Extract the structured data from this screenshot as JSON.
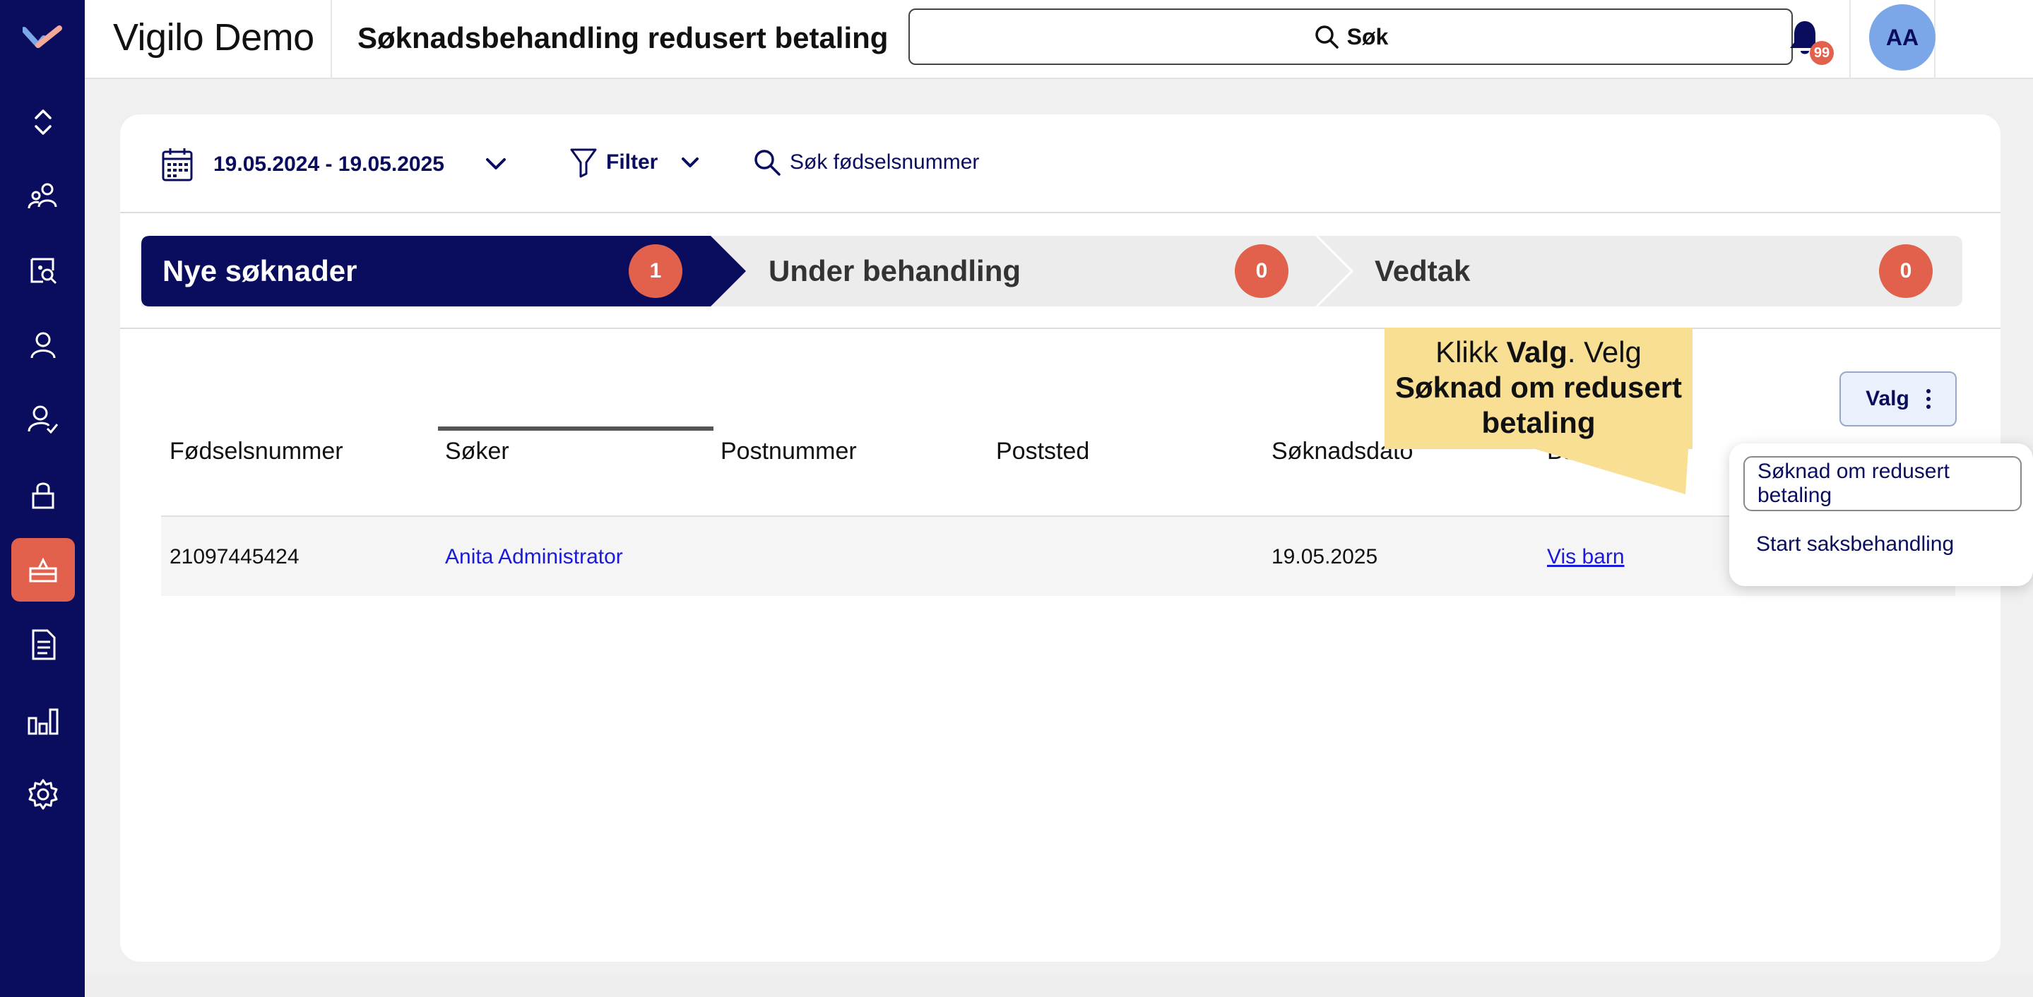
{
  "app": {
    "title": "Vigilo Demo",
    "page_title": "Søknadsbehandling redusert betaling"
  },
  "header": {
    "search_label": "Søk",
    "notification_count": "99",
    "avatar_initials": "AA"
  },
  "sidebar": {
    "items": [
      {
        "icon": "expand-collapse-icon"
      },
      {
        "icon": "users-icon"
      },
      {
        "icon": "search-user-icon"
      },
      {
        "icon": "user-icon"
      },
      {
        "icon": "user-check-icon"
      },
      {
        "icon": "lock-icon"
      },
      {
        "icon": "payment-icon",
        "active": true
      },
      {
        "icon": "document-icon"
      },
      {
        "icon": "bar-chart-icon"
      },
      {
        "icon": "gear-icon"
      }
    ],
    "active_color": "#e2614d",
    "bg_color": "#0a0d5e"
  },
  "toolbar": {
    "date_range": "19.05.2024 - 19.05.2025",
    "filter_label": "Filter",
    "search_ssn": "Søk fødselsnummer"
  },
  "stepper": {
    "steps": [
      {
        "label": "Nye søknader",
        "count": "1",
        "active": true
      },
      {
        "label": "Under behandling",
        "count": "0"
      },
      {
        "label": "Vedtak",
        "count": "0"
      }
    ]
  },
  "table": {
    "columns": [
      "Fødselsnummer",
      "Søker",
      "Postnummer",
      "Poststed",
      "Søknadsdato",
      "Barn"
    ],
    "rows": [
      {
        "ssn": "21097445424",
        "applicant": "Anita Administrator",
        "postnummer": "",
        "poststed": "",
        "date": "19.05.2025",
        "children": "Vis barn"
      }
    ]
  },
  "actions": {
    "valg_label": "Valg",
    "menu": [
      "Søknad om redusert betaling",
      "Start saksbehandling"
    ]
  },
  "callout": {
    "pre": "Klikk ",
    "bold1": "Valg",
    "mid": ". Velg ",
    "bold2": "Søknad om redusert betaling"
  }
}
